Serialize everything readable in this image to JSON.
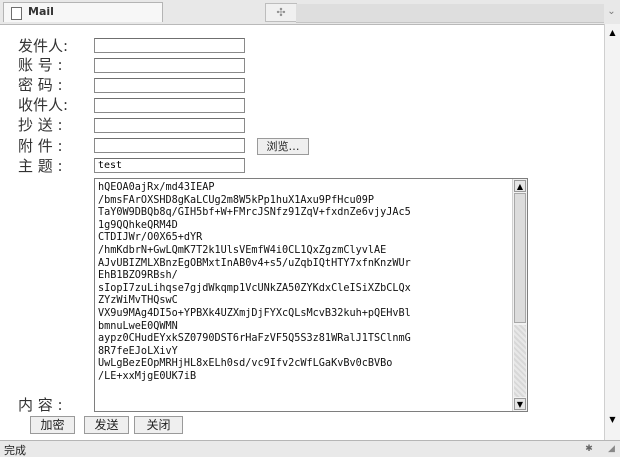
{
  "tab": {
    "title": "Mail",
    "new_tab_icon": "✣"
  },
  "form": {
    "labels": {
      "sender": "发件人:",
      "account": "账 号 :",
      "password": "密 码 :",
      "recipient": "收件人:",
      "cc": "抄 送 :",
      "attachment": "附 件 :",
      "subject": "主 题 :",
      "content": "内 容 :"
    },
    "values": {
      "sender": "",
      "account": "",
      "password": "",
      "recipient": "",
      "cc": "",
      "attachment": "",
      "subject": "test"
    },
    "browse_label": "浏览…",
    "content_text": "hQEOA0ajRx/md43IEAP\n/bmsFArOXSHD8gKaLCUg2m8W5kPp1huX1Axu9PfHcu09P\nTaY0W9DBQb8q/GIH5bf+W+FMrcJSNfz91ZqV+fxdnZe6vjyJAc5\n1g9QQhkeQRM4D\nCTDIJWr/O0X65+dYR\n/hmKdbrN+GwLQmK7T2k1UlsVEmfW4i0CL1QxZgzmClyvlAE\nAJvUBIZMLXBnzEgOBMxtInAB0v4+s5/uZqbIQtHTY7xfnKnzWUr\nEhB1BZO9RBsh/\nsIopI7zuLihqse7gjdWkqmp1VcUNkZA50ZYKdxCleISiXZbCLQx\nZYzWiMvTHQswC\nVX9u9MAg4DI5o+YPBXk4UZXmjDjFYXcQLsMcvB32kuh+pQEHvBl\nbmnuLweE0QWMN\naypz0CHudEYxkSZ0790DST6rHaFzVF5Q5S3z81WRalJ1TSClnmG\n8R7feEJoLXivY\nUwLgBezEOpMRHjHL8xELh0sd/vc9Ifv2cWfLGaKvBv0cBVBo\n/LE+xxMjgE0UK7iB"
  },
  "buttons": {
    "encrypt": "加密",
    "send": "发送",
    "close": "关闭"
  },
  "status": {
    "text": "完成"
  }
}
